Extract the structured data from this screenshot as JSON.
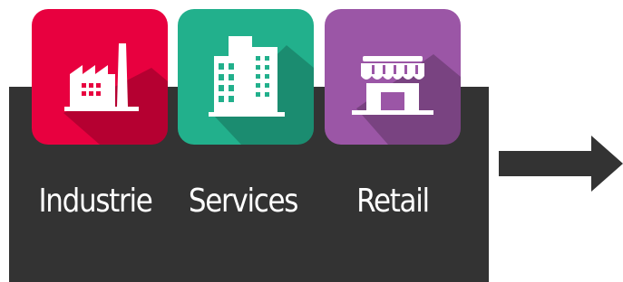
{
  "categories": [
    {
      "id": "industrie",
      "label": "Industrie",
      "icon": "factory-icon",
      "color": "#e8003f"
    },
    {
      "id": "services",
      "label": "Services",
      "icon": "office-buildings-icon",
      "color": "#22b08c"
    },
    {
      "id": "retail",
      "label": "Retail",
      "icon": "storefront-icon",
      "color": "#9b56a6"
    }
  ],
  "panel_color": "#333333",
  "arrow_icon": "arrow-right-icon"
}
